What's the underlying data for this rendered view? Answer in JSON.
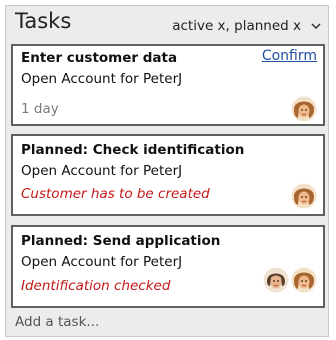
{
  "header": {
    "title": "Tasks",
    "filter_label": "active x, planned x",
    "filter_icon": "chevron-down-icon"
  },
  "tasks": [
    {
      "title": "Enter customer data",
      "subtitle": "Open Account for PeterJ",
      "status": "1 day",
      "action_label": "Confirm",
      "avatars": [
        "avatar-1"
      ]
    },
    {
      "title": "Planned: Check identification",
      "subtitle": "Open Account for PeterJ",
      "status": "Customer has to be created",
      "avatars": [
        "avatar-1"
      ]
    },
    {
      "title": "Planned: Send application",
      "subtitle": "Open Account for PeterJ",
      "status": "Identification checked",
      "avatars": [
        "avatar-2",
        "avatar-1"
      ]
    }
  ],
  "footer": {
    "add_task_label": "Add a task..."
  },
  "colors": {
    "link": "#1f4f9e",
    "alert": "#c41818",
    "muted": "#7a7a7a",
    "card_border": "#5f5f5f",
    "panel": "#ececec"
  }
}
